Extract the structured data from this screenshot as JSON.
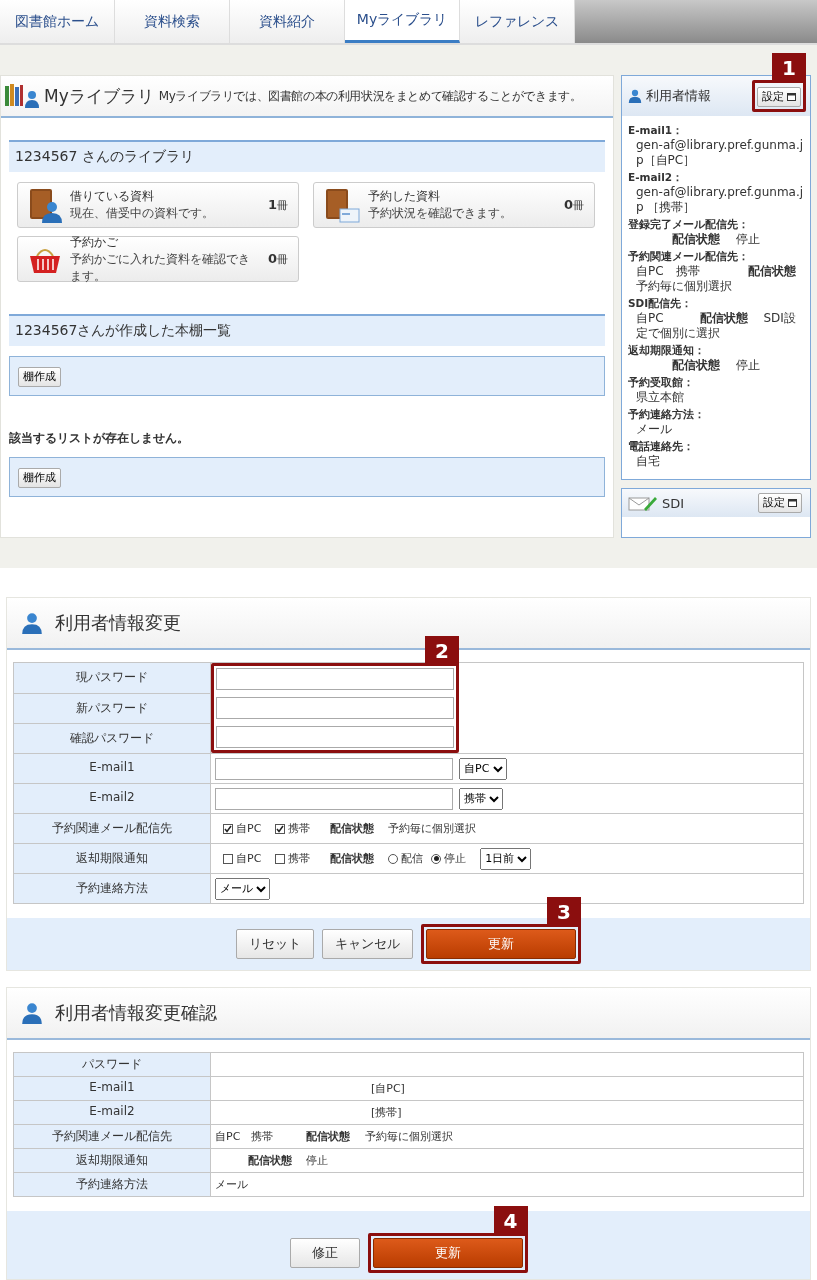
{
  "nav_tabs": [
    {
      "label": "図書館ホーム",
      "selected": false
    },
    {
      "label": "資料検索",
      "selected": false
    },
    {
      "label": "資料紹介",
      "selected": false
    },
    {
      "label": "Myライブラリ",
      "selected": true
    },
    {
      "label": "レファレンス",
      "selected": false
    }
  ],
  "my_library": {
    "title": "Myライブラリ",
    "description": "Myライブラリでは、図書館の本の利用状況をまとめて確認することができます。",
    "library_heading": "1234567 さんのライブラリ",
    "cards": [
      {
        "kind": "borrowed",
        "title": "借りている資料",
        "subtitle": "現在、借受中の資料です。",
        "count": "1",
        "unit": "冊"
      },
      {
        "kind": "reserved",
        "title": "予約した資料",
        "subtitle": "予約状況を確認できます。",
        "count": "0",
        "unit": "冊"
      },
      {
        "kind": "basket",
        "title": "予約かご",
        "subtitle": "予約かごに入れた資料を確認できます。",
        "count": "0",
        "unit": "冊"
      }
    ],
    "shelf_heading": "1234567さんが作成した本棚一覧",
    "shelf_button": "棚作成",
    "empty_message": "該当するリストが存在しません。",
    "shelf_button_bottom": "棚作成"
  },
  "user_info": {
    "title": "利用者情報",
    "settings_button": "設定",
    "callout": "1",
    "entries": [
      {
        "label": "E-mail1：",
        "value": "gen-af@library.pref.gunma.jp［自PC］"
      },
      {
        "label": "E-mail2：",
        "value": "gen-af@library.pref.gunma.jp ［携帯］"
      },
      {
        "label": "登録完了メール配信先：",
        "value": "　　　**配信状態**　 停止"
      },
      {
        "label": "予約関連メール配信先：",
        "value": "自PC　携帯　　　　**配信状態**予約毎に個別選択"
      },
      {
        "label": "SDI配信先：",
        "value": "自PC　　　**配信状態**　 SDI設定で個別に選択"
      },
      {
        "label": "返却期限通知：",
        "value": "　　　**配信状態**　 停止"
      },
      {
        "label": "予約受取館：",
        "value": "県立本館"
      },
      {
        "label": "予約連絡方法：",
        "value": "メール"
      },
      {
        "label": "電話連絡先：",
        "value": "自宅"
      }
    ]
  },
  "sdi": {
    "title": "SDI",
    "settings_button": "設定"
  },
  "change_form": {
    "title": "利用者情報変更",
    "password_callout": "2",
    "password_rows": [
      {
        "label": "現パスワード"
      },
      {
        "label": "新パスワード"
      },
      {
        "label": "確認パスワード"
      }
    ],
    "rows": [
      {
        "kind": "email",
        "label": "E-mail1",
        "select": "自PC"
      },
      {
        "kind": "email",
        "label": "E-mail2",
        "select": "携帯"
      },
      {
        "kind": "checks",
        "label": "予約関連メール配信先",
        "options": [
          {
            "label": "自PC",
            "checked": true
          },
          {
            "label": "携帯",
            "checked": true
          }
        ],
        "status_label": "配信状態",
        "status_text": "予約毎に個別選択"
      },
      {
        "kind": "checks_radio",
        "label": "返却期限通知",
        "options": [
          {
            "label": "自PC",
            "checked": false
          },
          {
            "label": "携帯",
            "checked": false
          }
        ],
        "status_label": "配信状態",
        "radios": [
          {
            "label": "配信",
            "selected": false
          },
          {
            "label": "停止",
            "selected": true
          }
        ],
        "select": "1日前"
      },
      {
        "kind": "select",
        "label": "予約連絡方法",
        "select": "メール"
      }
    ],
    "buttons": [
      {
        "kind": "plain",
        "label": "リセット"
      },
      {
        "kind": "plain",
        "label": "キャンセル"
      },
      {
        "kind": "primary",
        "label": "更新",
        "callout": "3"
      }
    ]
  },
  "confirm": {
    "title": "利用者情報変更確認",
    "rows": [
      {
        "kind": "plain",
        "label": "パスワード"
      },
      {
        "kind": "masked",
        "label": "E-mail1",
        "value": "[自PC]"
      },
      {
        "kind": "masked",
        "label": "E-mail2",
        "value": "[携帯]"
      },
      {
        "kind": "plain",
        "label": "予約関連メール配信先",
        "value": "自PC　携帯　　　**配信状態**　 予約毎に個別選択"
      },
      {
        "kind": "plain",
        "label": "返却期限通知",
        "value": "　　　**配信状態**　 停止"
      },
      {
        "kind": "plain",
        "label": "予約連絡方法",
        "value": "メール"
      }
    ],
    "buttons": [
      {
        "kind": "plain",
        "label": "修正"
      },
      {
        "kind": "primary",
        "label": "更新",
        "callout": "4"
      }
    ]
  }
}
